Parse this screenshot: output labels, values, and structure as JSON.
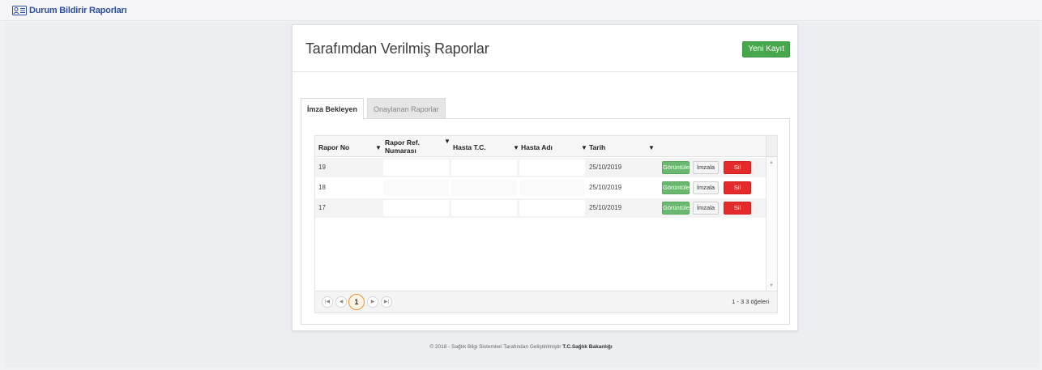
{
  "topbar": {
    "title": "Durum Bildirir Raporları",
    "icon": "contact-card-icon"
  },
  "page": {
    "title": "Tarafımdan Verilmiş Raporlar",
    "new_button": "Yeni Kayıt"
  },
  "tabs": [
    {
      "label": "İmza Bekleyen",
      "active": true
    },
    {
      "label": "Onaylanan Raporlar",
      "active": false
    }
  ],
  "grid": {
    "columns": {
      "rapor_no": "Rapor No",
      "rapor_ref_1": "Rapor Ref.",
      "rapor_ref_2": "Numarası",
      "hasta_tc": "Hasta T.C.",
      "hasta_adi": "Hasta Adı",
      "tarih": "Tarih"
    },
    "rows": [
      {
        "no": "19",
        "tarih": "25/10/2019",
        "view": "Görüntüle",
        "sign": "İmzala",
        "delete": "Sil"
      },
      {
        "no": "18",
        "tarih": "25/10/2019",
        "view": "Görüntüle",
        "sign": "İmzala",
        "delete": "Sil"
      },
      {
        "no": "17",
        "tarih": "25/10/2019",
        "view": "Görüntüle",
        "sign": "İmzala",
        "delete": "Sil"
      }
    ],
    "pager": {
      "current_page": "1",
      "info": "1 - 3 3 öğeleri"
    }
  },
  "footer": {
    "text": "© 2018 - Sağlık Bilgi Sistemleri Tarafından Geliştirilmiştir",
    "owner": "T.C.Sağlık Bakanlığı"
  },
  "colors": {
    "primary_green": "#46a84a",
    "delete_red": "#e52a2a",
    "link_blue": "#2c4f9e",
    "pager_active": "#e8943a"
  }
}
